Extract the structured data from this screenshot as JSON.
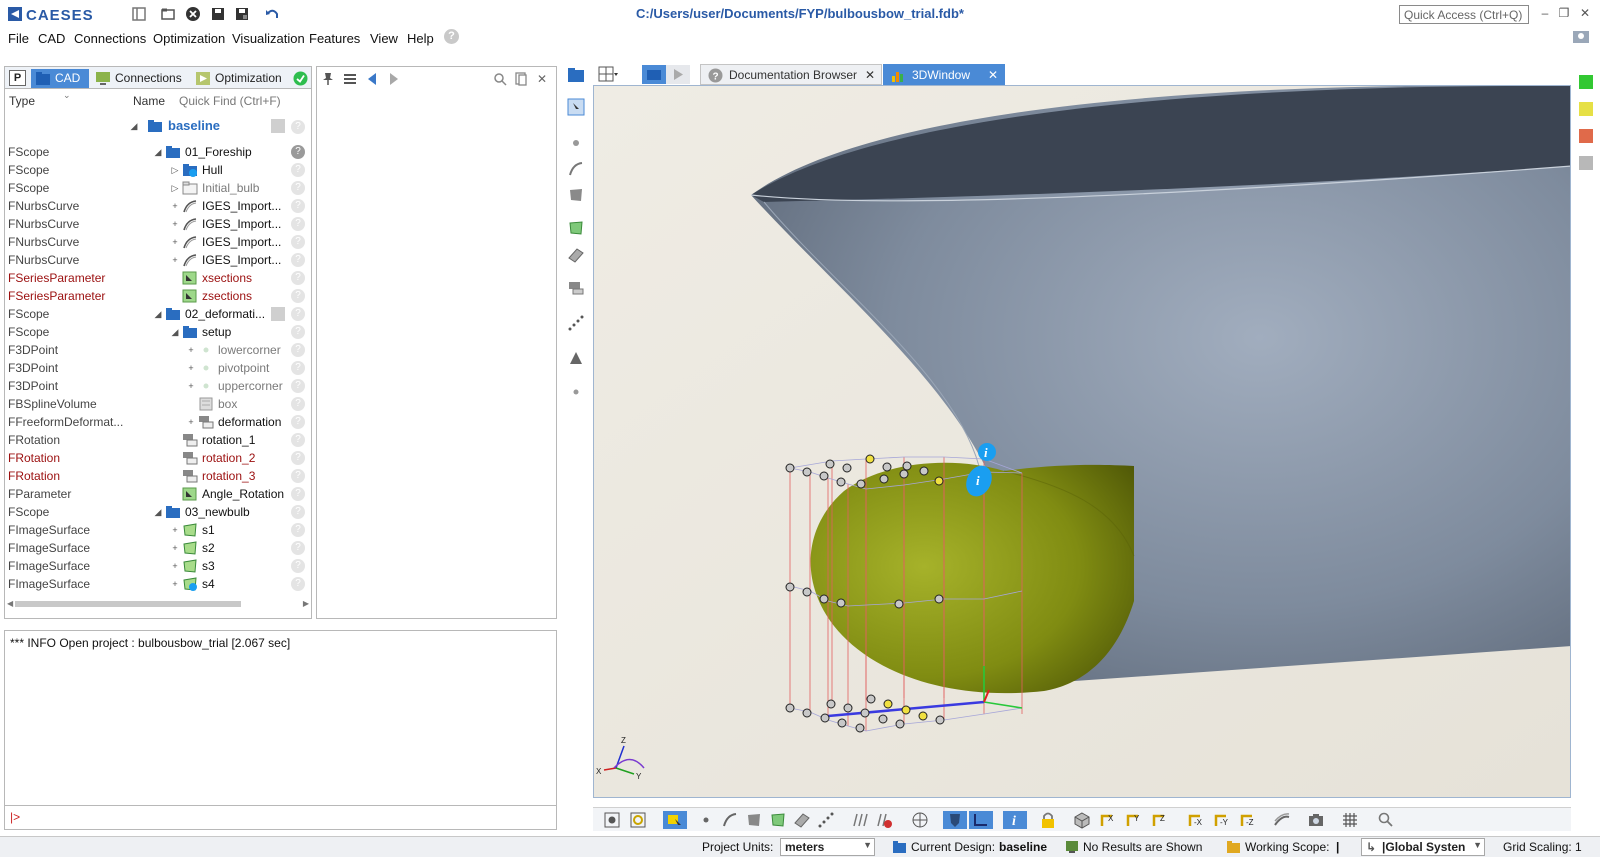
{
  "app": {
    "logo_text": "CAESES",
    "title": "C:/Users/user/Documents/FYP/bulbousbow_trial.fdb*",
    "quick_access_placeholder": "Quick Access (Ctrl+Q)"
  },
  "menu": [
    "File",
    "CAD",
    "Connections",
    "Optimization",
    "Visualization",
    "Features",
    "View",
    "Help"
  ],
  "left_panel": {
    "tabs": [
      {
        "label": "CAD",
        "active": true
      },
      {
        "label": "Connections",
        "active": false
      },
      {
        "label": "Optimization",
        "active": false
      }
    ],
    "tab_p_label": "P",
    "columns": {
      "type": "Type",
      "name": "Name",
      "quick_find": "Quick Find (Ctrl+F)"
    },
    "root": "baseline",
    "rows": [
      {
        "type": "FScope",
        "name": "01_Foreship",
        "indent": 1,
        "arrow": "◢",
        "icon": "folder"
      },
      {
        "type": "FScope",
        "name": "Hull",
        "indent": 2,
        "arrow": "▷",
        "icon": "folder-info"
      },
      {
        "type": "FScope",
        "name": "Initial_bulb",
        "indent": 2,
        "arrow": "▷",
        "icon": "folder-light",
        "gray": true
      },
      {
        "type": "FNurbsCurve",
        "name": "IGES_Import...",
        "indent": 2,
        "arrow": "+",
        "icon": "curve"
      },
      {
        "type": "FNurbsCurve",
        "name": "IGES_Import...",
        "indent": 2,
        "arrow": "+",
        "icon": "curve"
      },
      {
        "type": "FNurbsCurve",
        "name": "IGES_Import...",
        "indent": 2,
        "arrow": "+",
        "icon": "curve"
      },
      {
        "type": "FNurbsCurve",
        "name": "IGES_Import...",
        "indent": 2,
        "arrow": "+",
        "icon": "curve"
      },
      {
        "type": "FSeriesParameter",
        "name": "xsections",
        "indent": 2,
        "arrow": "",
        "icon": "param",
        "red": true
      },
      {
        "type": "FSeriesParameter",
        "name": "zsections",
        "indent": 2,
        "arrow": "",
        "icon": "param",
        "red": true
      },
      {
        "type": "FScope",
        "name": "02_deformati...",
        "indent": 1,
        "arrow": "◢",
        "icon": "folder"
      },
      {
        "type": "FScope",
        "name": "setup",
        "indent": 2,
        "arrow": "◢",
        "icon": "folder"
      },
      {
        "type": "F3DPoint",
        "name": "lowercorner",
        "indent": 3,
        "arrow": "+",
        "icon": "point",
        "gray": true
      },
      {
        "type": "F3DPoint",
        "name": "pivotpoint",
        "indent": 3,
        "arrow": "+",
        "icon": "point",
        "gray": true
      },
      {
        "type": "F3DPoint",
        "name": "uppercorner",
        "indent": 3,
        "arrow": "+",
        "icon": "point",
        "gray": true
      },
      {
        "type": "FBSplineVolume",
        "name": "box",
        "indent": 3,
        "arrow": "",
        "icon": "box",
        "gray": true
      },
      {
        "type": "FFreeformDeformat...",
        "name": "deformation",
        "indent": 3,
        "arrow": "+",
        "icon": "deform"
      },
      {
        "type": "FRotation",
        "name": "rotation_1",
        "indent": 2,
        "arrow": "",
        "icon": "deform"
      },
      {
        "type": "FRotation",
        "name": "rotation_2",
        "indent": 2,
        "arrow": "",
        "icon": "deform",
        "red": true
      },
      {
        "type": "FRotation",
        "name": "rotation_3",
        "indent": 2,
        "arrow": "",
        "icon": "deform",
        "red": true
      },
      {
        "type": "FParameter",
        "name": "Angle_Rotation",
        "indent": 2,
        "arrow": "",
        "icon": "param"
      },
      {
        "type": "FScope",
        "name": "03_newbulb",
        "indent": 1,
        "arrow": "◢",
        "icon": "folder"
      },
      {
        "type": "FImageSurface",
        "name": "s1",
        "indent": 2,
        "arrow": "+",
        "icon": "surface"
      },
      {
        "type": "FImageSurface",
        "name": "s2",
        "indent": 2,
        "arrow": "+",
        "icon": "surface"
      },
      {
        "type": "FImageSurface",
        "name": "s3",
        "indent": 2,
        "arrow": "+",
        "icon": "surface"
      },
      {
        "type": "FImageSurface",
        "name": "s4",
        "indent": 2,
        "arrow": "+",
        "icon": "surface-info"
      }
    ]
  },
  "console": {
    "log": "*** INFO Open project : bulbousbow_trial [2.067 sec]",
    "prompt": "|>"
  },
  "view_tabs": [
    {
      "label": "Documentation Browser",
      "active": false
    },
    {
      "label": "3DWindow",
      "active": true
    }
  ],
  "status": {
    "project_units_label": "Project Units:",
    "project_units_value": "meters",
    "current_design_label": "Current Design:",
    "current_design_value": "baseline",
    "results": "No Results are Shown",
    "working_scope_label": "Working Scope:",
    "working_scope_value": "|",
    "coordinate_system": "|Global Systen",
    "grid_scaling": "Grid Scaling: 1"
  },
  "axes": {
    "z": "Z",
    "x": "X",
    "y": "Y"
  },
  "colors": {
    "accent": "#4a8ad6",
    "hull": "#7b889a",
    "bulb": "#7e8a10",
    "viewport_bg": "#ede9e0"
  }
}
